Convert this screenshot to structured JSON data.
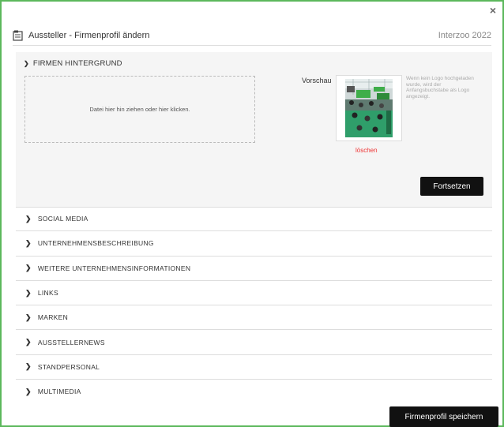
{
  "dialog": {
    "close_symbol": "×",
    "title": "Aussteller - Firmenprofil ändern",
    "event": "Interzoo 2022"
  },
  "background_section": {
    "heading": "FIRMEN HINTERGRUND",
    "dropzone_text": "Datei hier hin ziehen oder hier klicken.",
    "preview_label": "Vorschau",
    "note": "Wenn kein Logo hochgeladen wurde, wird der Anfangsbuchstabe als Logo angezeigt.",
    "delete_label": "löschen",
    "continue_label": "Fortsetzen"
  },
  "sections": [
    {
      "label": "SOCIAL MEDIA"
    },
    {
      "label": "UNTERNEHMENSBESCHREIBUNG"
    },
    {
      "label": "WEITERE UNTERNEHMENSINFORMATIONEN"
    },
    {
      "label": "LINKS"
    },
    {
      "label": "MARKEN"
    },
    {
      "label": "AUSSTELLERNEWS"
    },
    {
      "label": "STANDPERSONAL"
    },
    {
      "label": "MULTIMEDIA"
    }
  ],
  "footer": {
    "save_label": "Firmenprofil speichern"
  },
  "colors": {
    "frame_border": "#5cb85c",
    "delete_text": "#e33333",
    "button_bg": "#111111"
  }
}
